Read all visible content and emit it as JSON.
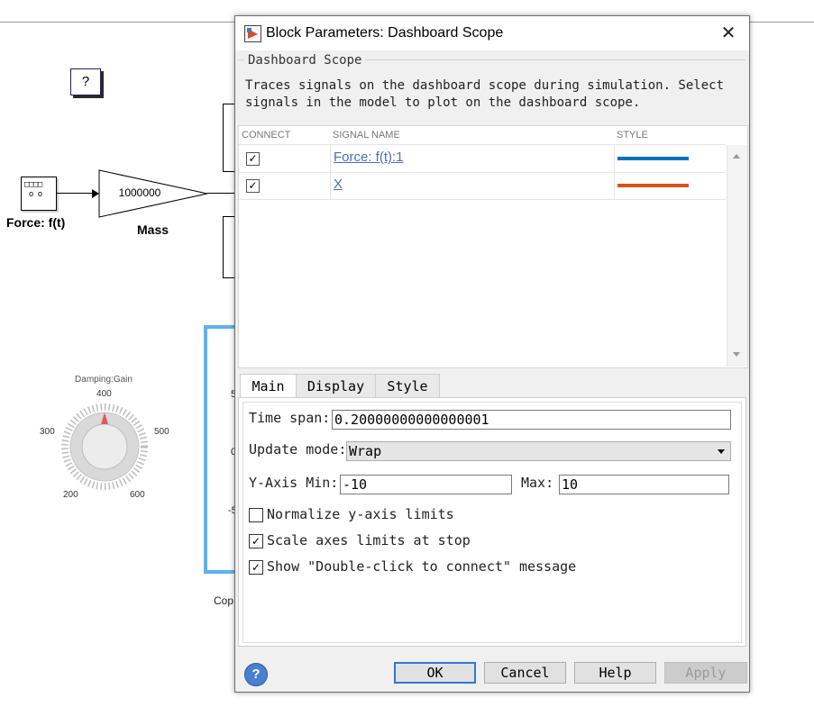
{
  "canvas": {
    "help_block": "?",
    "source_block_label": "Force: f(t)",
    "gain_value": "1000000",
    "gain_label": "Mass",
    "knob": {
      "title": "Damping:Gain",
      "ticks": [
        "400",
        "300",
        "500",
        "200",
        "600"
      ]
    },
    "fragments": [
      "5",
      "0",
      "-5",
      "Cop"
    ]
  },
  "dialog": {
    "title": "Block Parameters: Dashboard Scope",
    "close_icon": "close-icon",
    "group_title": "Dashboard Scope",
    "description": "Traces signals on the dashboard scope during simulation. Select signals in the model to plot on the dashboard scope.",
    "table": {
      "headers": [
        "CONNECT",
        "SIGNAL NAME",
        "STYLE"
      ],
      "rows": [
        {
          "connected": true,
          "signal": "Force: f(t):1",
          "color": "#0072bd"
        },
        {
          "connected": true,
          "signal": "X",
          "color": "#d95319"
        }
      ]
    },
    "tabs": [
      "Main",
      "Display",
      "Style"
    ],
    "active_tab": "Main",
    "main": {
      "time_span_label": "Time span:",
      "time_span_value": "0.20000000000000001",
      "update_mode_label": "Update mode:",
      "update_mode_value": "Wrap",
      "ymin_label": "Y-Axis Min:",
      "ymin_value": "-10",
      "ymax_label": "Max:",
      "ymax_value": "10",
      "checkboxes": [
        {
          "label": "Normalize y-axis limits",
          "checked": false
        },
        {
          "label": "Scale axes limits at stop",
          "checked": true
        },
        {
          "label": "Show \"Double-click to connect\" message",
          "checked": true
        }
      ]
    },
    "buttons": {
      "ok": "OK",
      "cancel": "Cancel",
      "help": "Help",
      "apply": "Apply"
    }
  }
}
